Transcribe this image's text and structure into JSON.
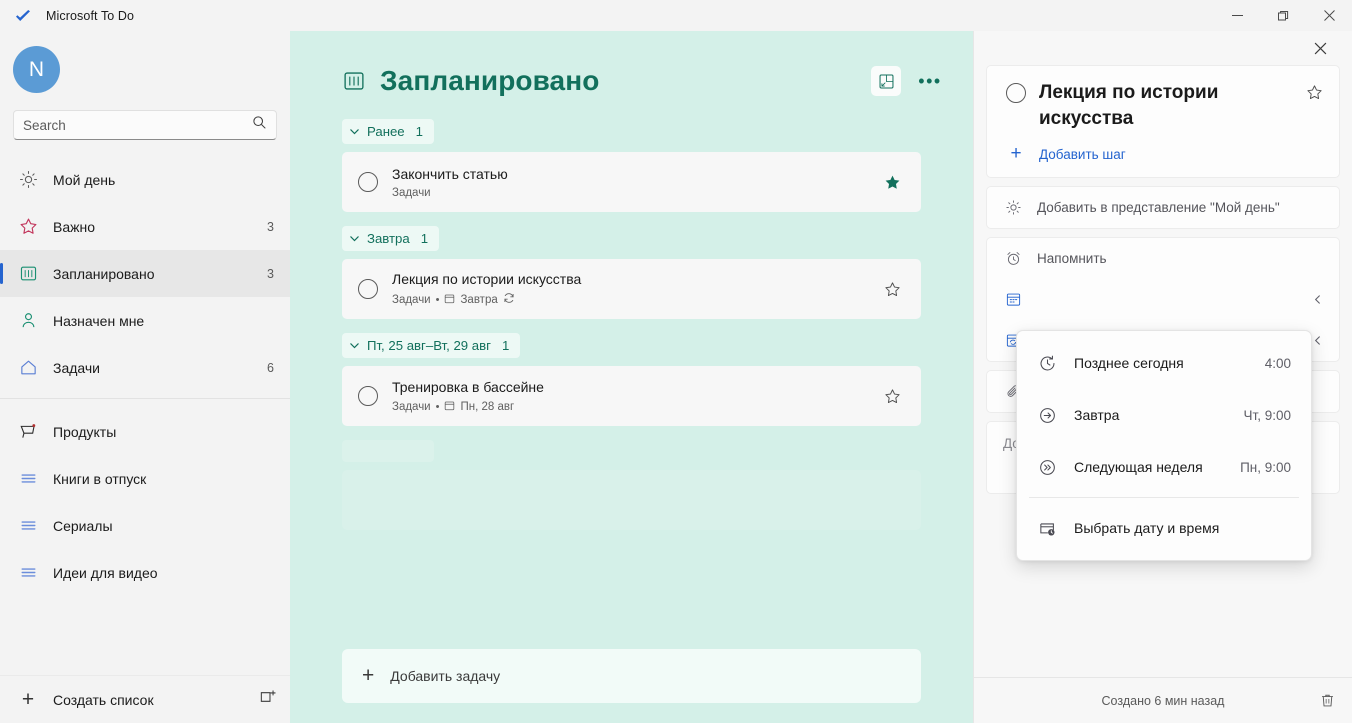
{
  "window": {
    "title": "Microsoft To Do",
    "logo_icon": "checkmark-logo",
    "minimize_label": "—",
    "maximize_label": "❐",
    "close_label": "✕"
  },
  "sidebar": {
    "avatar_initial": "N",
    "search": {
      "value": "",
      "placeholder": "Search",
      "icon": "search-icon"
    },
    "smart_lists": [
      {
        "label": "Мой день",
        "count": "",
        "icon": "sun-icon",
        "active": false
      },
      {
        "label": "Важно",
        "count": "3",
        "icon": "star-icon",
        "active": false
      },
      {
        "label": "Запланировано",
        "count": "3",
        "icon": "planned-icon",
        "active": true
      },
      {
        "label": "Назначен мне",
        "count": "",
        "icon": "person-icon",
        "active": false
      },
      {
        "label": "Задачи",
        "count": "6",
        "icon": "home-icon",
        "active": false
      }
    ],
    "custom_lists": [
      {
        "label": "Продукты",
        "count": "",
        "icon": "cart-icon"
      },
      {
        "label": "Книги в отпуск",
        "count": "",
        "icon": "list-icon"
      },
      {
        "label": "Сериалы",
        "count": "",
        "icon": "list-icon"
      },
      {
        "label": "Идеи для видео",
        "count": "",
        "icon": "list-icon"
      }
    ],
    "new_list_label": "Создать список",
    "new_list_icon": "plus-icon",
    "new_group_icon": "new-group-icon"
  },
  "main": {
    "title": "Запланировано",
    "title_icon": "planned-icon",
    "theme_button_icon": "background-image-icon",
    "more_button_icon": "ellipsis-icon",
    "accent_color": "#12705c",
    "background_color": "#d4f0e8",
    "groups": [
      {
        "label": "Ранее",
        "count": "1",
        "tasks": [
          {
            "title": "Закончить статью",
            "list": "Задачи",
            "due": "",
            "repeat": false,
            "starred": true
          }
        ]
      },
      {
        "label": "Завтра",
        "count": "1",
        "tasks": [
          {
            "title": "Лекция по истории искусства",
            "list": "Задачи",
            "due": "Завтра",
            "repeat": true,
            "starred": false
          }
        ]
      },
      {
        "label": "Пт, 25 авг–Вт, 29 авг",
        "count": "1",
        "tasks": [
          {
            "title": "Тренировка в бассейне",
            "list": "Задачи",
            "due": "Пн, 28 авг",
            "repeat": false,
            "starred": false
          }
        ]
      }
    ],
    "add_task_label": "Добавить задачу",
    "add_task_icon": "plus-icon"
  },
  "detail": {
    "close_icon": "close-icon",
    "task_title": "Лекция по истории искусства",
    "star_icon": "star-outline-icon",
    "add_step_label": "Добавить шаг",
    "add_step_icon": "plus-icon",
    "add_step_color": "#2564cf",
    "my_day_label": "Добавить в представление \"Мой день\"",
    "my_day_icon": "sun-icon",
    "remind_label": "Напомнить",
    "remind_icon": "alarm-icon",
    "due_icon": "calendar-due-icon",
    "repeat_icon": "calendar-repeat-icon",
    "file_icon": "paperclip-icon",
    "note_placeholder": "Добавить заметку",
    "created_label": "Создано 6 мин назад",
    "delete_icon": "trash-icon",
    "chevron_icon": "chevron-left-icon"
  },
  "reminder_menu": {
    "items": [
      {
        "label": "Позднее сегодня",
        "value": "4:00",
        "icon": "clock-arrow-icon"
      },
      {
        "label": "Завтра",
        "value": "Чт, 9:00",
        "icon": "arrow-right-circle-icon"
      },
      {
        "label": "Следующая неделя",
        "value": "Пн, 9:00",
        "icon": "double-arrow-circle-icon"
      }
    ],
    "custom": {
      "label": "Выбрать дату и время",
      "icon": "calendar-clock-icon"
    }
  }
}
